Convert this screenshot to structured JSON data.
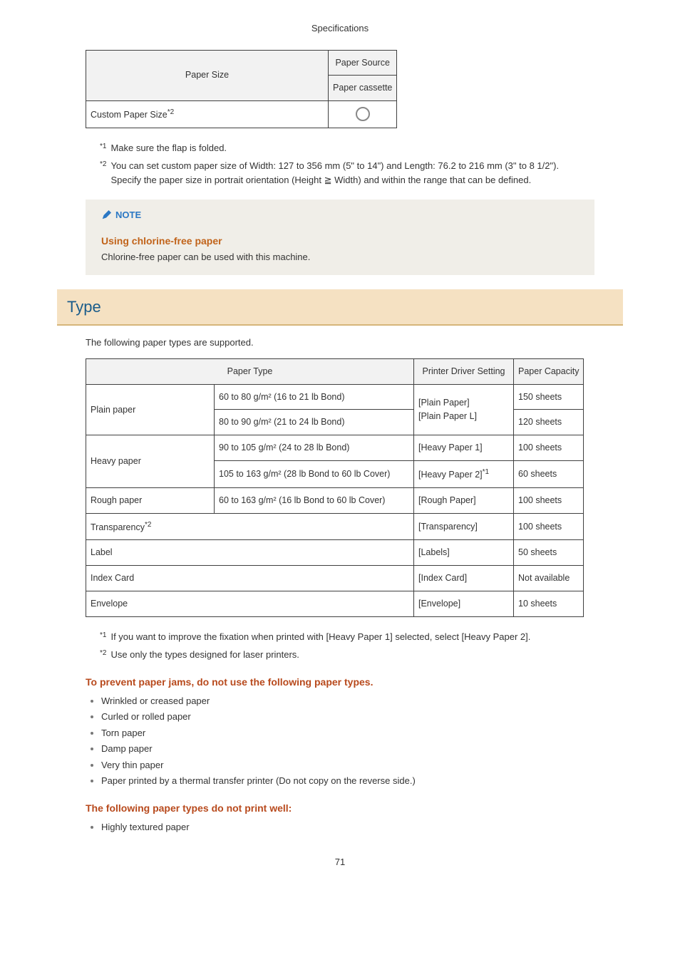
{
  "header": "Specifications",
  "table1": {
    "h_size": "Paper Size",
    "h_source": "Paper Source",
    "h_cassette": "Paper cassette",
    "row1": "Custom Paper Size",
    "row1_sup": "*2"
  },
  "fn1_num": "*1",
  "fn1_text": "Make sure the flap is folded.",
  "fn2_num": "*2",
  "fn2_text_a": "You can set custom paper size of Width: 127 to 356 mm (5\" to 14\") and Length: 76.2 to 216 mm (3\" to 8 1/2\").",
  "fn2_text_b": "Specify the paper size in portrait orientation (Height ",
  "fn2_text_c": " Width) and within the range that can be defined.",
  "ge_symbol": "≧",
  "note_label": "NOTE",
  "note_h": "Using chlorine-free paper",
  "note_p": "Chlorine-free paper can be used with this machine.",
  "section": "Type",
  "intro": "The following paper types are supported.",
  "t2": {
    "h_type": "Paper Type",
    "h_driver": "Printer Driver Setting",
    "h_cap": "Paper Capacity",
    "r1a": "Plain paper",
    "r1b1": "60 to 80 g/m² (16 to 21 lb Bond)",
    "r1b2": "80 to 90 g/m² (21 to 24 lb Bond)",
    "r1c": "[Plain Paper]\n[Plain Paper L]",
    "r1d1": "150 sheets",
    "r1d2": "120 sheets",
    "r2a": "Heavy paper",
    "r2b1": "90 to 105 g/m² (24 to 28 lb Bond)",
    "r2b2": "105 to 163 g/m² (28 lb Bond to 60 lb Cover)",
    "r2c1": "[Heavy Paper 1]",
    "r2c2a": "[Heavy Paper 2]",
    "r2c2b": "*1",
    "r2d1": "100 sheets",
    "r2d2": "60 sheets",
    "r3a": "Rough paper",
    "r3b": "60 to 163 g/m² (16 lb Bond to 60 lb Cover)",
    "r3c": "[Rough Paper]",
    "r3d": "100 sheets",
    "r4a": "Transparency",
    "r4a_sup": "*2",
    "r4c": "[Transparency]",
    "r4d": "100 sheets",
    "r5a": "Label",
    "r5c": "[Labels]",
    "r5d": "50 sheets",
    "r6a": "Index Card",
    "r6c": "[Index Card]",
    "r6d": "Not available",
    "r7a": "Envelope",
    "r7c": "[Envelope]",
    "r7d": "10 sheets"
  },
  "fn3_num": "*1",
  "fn3_text": "If you want to improve the fixation when printed with [Heavy Paper 1] selected, select [Heavy Paper 2].",
  "fn4_num": "*2",
  "fn4_text": "Use only the types designed for laser printers.",
  "warn1_h": "To prevent paper jams, do not use the following paper types.",
  "warn1_items": [
    "Wrinkled or creased paper",
    "Curled or rolled paper",
    "Torn paper",
    "Damp paper",
    "Very thin paper",
    "Paper printed by a thermal transfer printer (Do not copy on the reverse side.)"
  ],
  "warn2_h": "The following paper types do not print well:",
  "warn2_items": [
    "Highly textured paper"
  ],
  "pagenum": "71"
}
